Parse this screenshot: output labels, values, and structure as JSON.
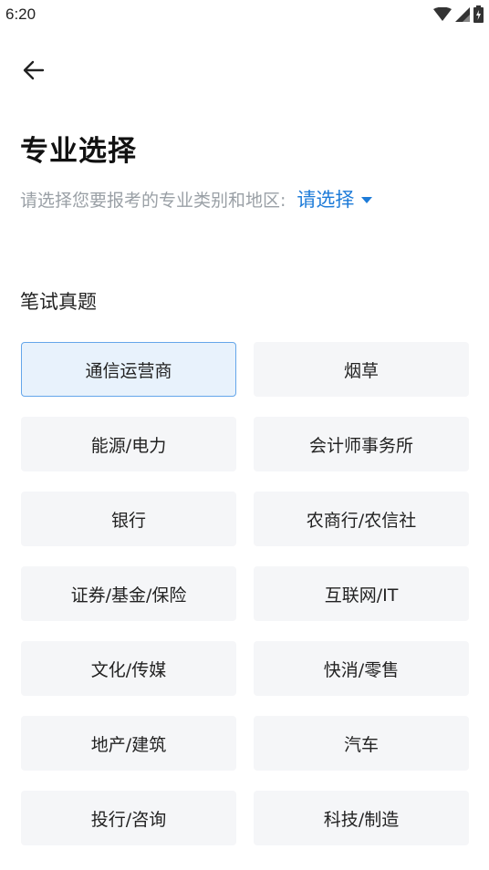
{
  "status_bar": {
    "time": "6:20"
  },
  "header": {
    "back_icon": "arrow-left-icon"
  },
  "page": {
    "title": "专业选择",
    "subtitle": "请选择您要报考的专业类别和地区:",
    "region_select_label": "请选择"
  },
  "section": {
    "title": "笔试真题"
  },
  "categories": [
    {
      "label": "通信运营商",
      "selected": true
    },
    {
      "label": "烟草",
      "selected": false
    },
    {
      "label": "能源/电力",
      "selected": false
    },
    {
      "label": "会计师事务所",
      "selected": false
    },
    {
      "label": "银行",
      "selected": false
    },
    {
      "label": "农商行/农信社",
      "selected": false
    },
    {
      "label": "证券/基金/保险",
      "selected": false
    },
    {
      "label": "互联网/IT",
      "selected": false
    },
    {
      "label": "文化/传媒",
      "selected": false
    },
    {
      "label": "快消/零售",
      "selected": false
    },
    {
      "label": "地产/建筑",
      "selected": false
    },
    {
      "label": "汽车",
      "selected": false
    },
    {
      "label": "投行/咨询",
      "selected": false
    },
    {
      "label": "科技/制造",
      "selected": false
    }
  ],
  "colors": {
    "accent": "#1d7bd8",
    "selected_bg": "#e8f2fc",
    "selected_border": "#64a6ea",
    "item_bg": "#f5f6f8",
    "muted_text": "#9aa0a6"
  }
}
